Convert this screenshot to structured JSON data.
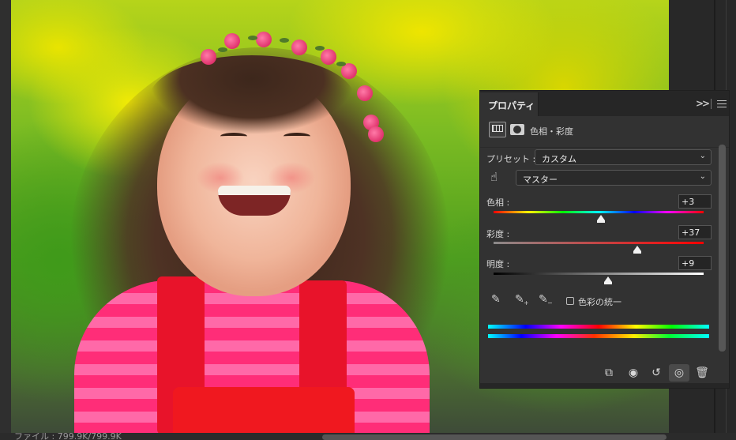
{
  "status": {
    "text": "ファイル : 799.9K/799.9K"
  },
  "panel": {
    "tab_label": "プロパティ",
    "collapse_icon": "double-chevron-right-icon",
    "menu_icon": "hamburger-menu-icon",
    "adjustment_title": "色相・彩度",
    "preset": {
      "label": "プリセット :",
      "value": "カスタム"
    },
    "channel": {
      "value": "マスター"
    },
    "sliders": [
      {
        "label": "色相 :",
        "value": "+3",
        "position": 0.51,
        "track": "hue"
      },
      {
        "label": "彩度 :",
        "value": "+37",
        "position": 0.685,
        "track": "saturation"
      },
      {
        "label": "明度 :",
        "value": "+9",
        "position": 0.545,
        "track": "lightness"
      }
    ],
    "colorize_label": "色彩の統一",
    "colorize_checked": false,
    "footer_buttons": [
      {
        "name": "clip-to-layer-button",
        "icon": "clip-icon",
        "glyph": "⬚"
      },
      {
        "name": "view-previous-button",
        "icon": "view-previous-icon",
        "glyph": "◉"
      },
      {
        "name": "reset-button",
        "icon": "reset-icon",
        "glyph": "↺"
      },
      {
        "name": "toggle-visibility-button",
        "icon": "eye-icon",
        "glyph": "👁"
      },
      {
        "name": "delete-button",
        "icon": "trash-icon",
        "glyph": "🗑"
      }
    ]
  },
  "colors": {
    "panel_bg": "#323232",
    "header_bg": "#262626",
    "text": "#d6d6d6"
  }
}
